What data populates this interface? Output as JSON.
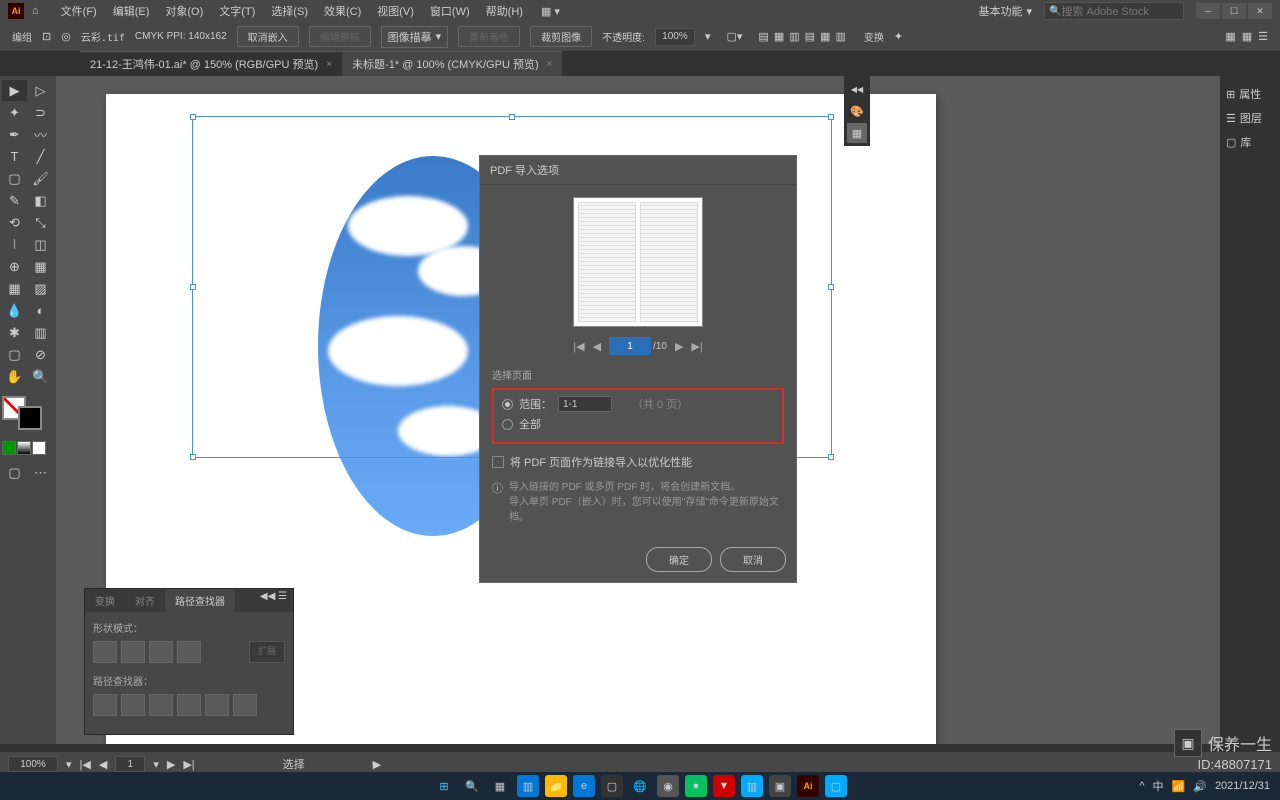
{
  "menubar": {
    "items": [
      "文件(F)",
      "编辑(E)",
      "对象(O)",
      "文字(T)",
      "选择(S)",
      "效果(C)",
      "视图(V)",
      "窗口(W)",
      "帮助(H)"
    ],
    "workspace": "基本功能",
    "search_placeholder": "搜索 Adobe Stock"
  },
  "optbar": {
    "label": "编组",
    "filename": "云彩.tif",
    "colormode": "CMYK PPI: 140x162",
    "cancel_embed": "取消嵌入",
    "insert": "图像描摹",
    "crop": "裁剪图像",
    "opacity_label": "不透明度:",
    "opacity_val": "100%",
    "transform": "变换",
    "edit_original": "编辑原稿",
    "relink": "重新着色"
  },
  "tabs": [
    {
      "label": "21-12-王鸿伟-01.ai* @ 150% (RGB/GPU 预览)",
      "active": false
    },
    {
      "label": "未标题-1* @ 100% (CMYK/GPU 预览)",
      "active": true
    }
  ],
  "right_dock": [
    {
      "icon": "⊞",
      "label": "属性"
    },
    {
      "icon": "☰",
      "label": "图层"
    },
    {
      "icon": "▢",
      "label": "库"
    }
  ],
  "dialog": {
    "title": "PDF 导入选项",
    "page_current": "1",
    "page_total": "/10",
    "select_page_label": "选择页面",
    "range_label": "范围：",
    "range_val": "1-1",
    "range_suffix": "（共 0 页）",
    "all_label": "全部",
    "link_checkbox": "将 PDF 页面作为链接导入以优化性能",
    "hint1": "导入链接的 PDF 或多页 PDF 时，将会创建新文档。",
    "hint2": "导入单页 PDF（嵌入）时，您可以使用\"存储\"命令更新原始文档。",
    "ok": "确定",
    "cancel": "取消"
  },
  "pathfinder": {
    "tabs": [
      "变换",
      "对齐",
      "路径查找器"
    ],
    "shape_mode": "形状模式：",
    "expand": "扩展",
    "pathfinder_label": "路径查找器："
  },
  "statusbar": {
    "zoom": "100%",
    "page": "1",
    "select": "选择"
  },
  "watermark": {
    "brand": "保养一生",
    "id": "ID:48807171"
  },
  "taskbar_date": "2021/12/31"
}
